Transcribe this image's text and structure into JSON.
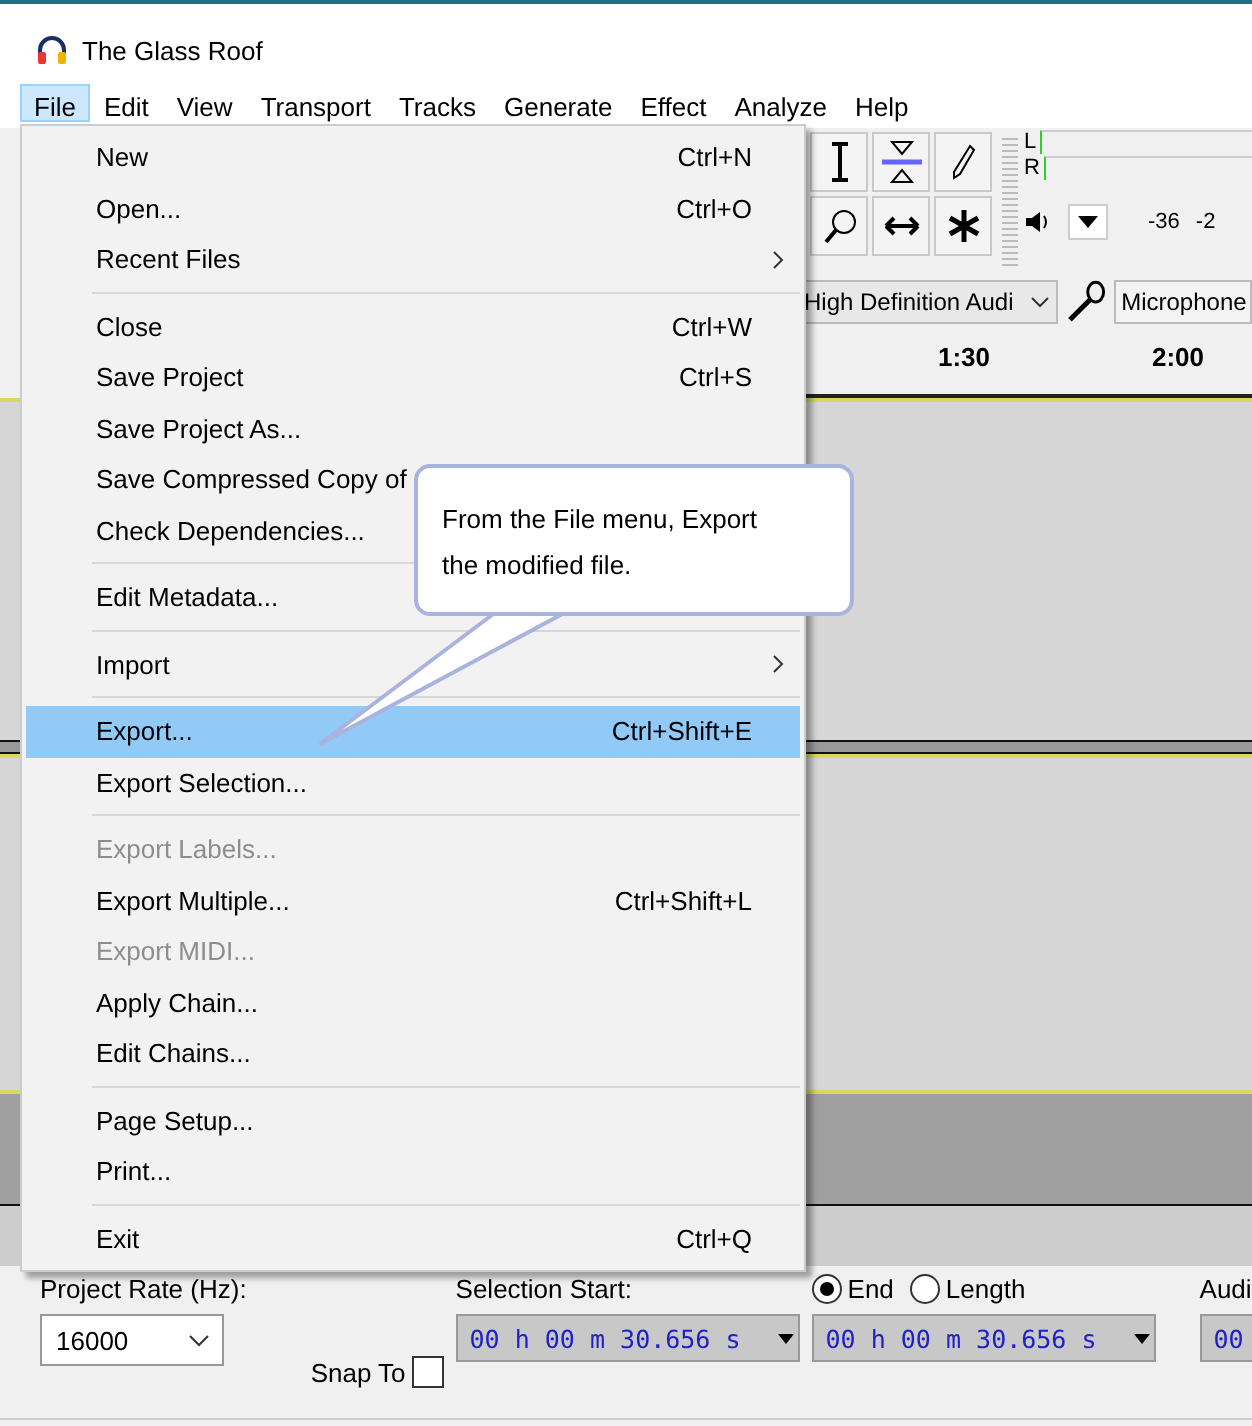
{
  "window": {
    "title": "The Glass Roof"
  },
  "menubar": [
    {
      "label": "File",
      "selected": true
    },
    {
      "label": "Edit",
      "selected": false
    },
    {
      "label": "View",
      "selected": false
    },
    {
      "label": "Transport",
      "selected": false
    },
    {
      "label": "Tracks",
      "selected": false
    },
    {
      "label": "Generate",
      "selected": false
    },
    {
      "label": "Effect",
      "selected": false
    },
    {
      "label": "Analyze",
      "selected": false
    },
    {
      "label": "Help",
      "selected": false
    }
  ],
  "file_menu": [
    {
      "kind": "item",
      "label": "New",
      "shortcut": "Ctrl+N",
      "submenu": false,
      "disabled": false,
      "selected": false
    },
    {
      "kind": "item",
      "label": "Open...",
      "shortcut": "Ctrl+O",
      "submenu": false,
      "disabled": false,
      "selected": false
    },
    {
      "kind": "item",
      "label": "Recent Files",
      "submenu": true,
      "disabled": false,
      "selected": false
    },
    {
      "kind": "separator"
    },
    {
      "kind": "item",
      "label": "Close",
      "shortcut": "Ctrl+W",
      "submenu": false,
      "disabled": false,
      "selected": false
    },
    {
      "kind": "item",
      "label": "Save Project",
      "shortcut": "Ctrl+S",
      "submenu": false,
      "disabled": false,
      "selected": false
    },
    {
      "kind": "item",
      "label": "Save Project As...",
      "submenu": false,
      "disabled": false,
      "selected": false
    },
    {
      "kind": "item",
      "label": "Save Compressed Copy of",
      "submenu": false,
      "disabled": false,
      "selected": false
    },
    {
      "kind": "item",
      "label": "Check Dependencies...",
      "submenu": false,
      "disabled": false,
      "selected": false
    },
    {
      "kind": "separator"
    },
    {
      "kind": "item",
      "label": "Edit Metadata...",
      "submenu": false,
      "disabled": false,
      "selected": false
    },
    {
      "kind": "separator"
    },
    {
      "kind": "item",
      "label": "Import",
      "submenu": true,
      "disabled": false,
      "selected": false
    },
    {
      "kind": "separator"
    },
    {
      "kind": "item",
      "label": "Export...",
      "shortcut": "Ctrl+Shift+E",
      "submenu": false,
      "disabled": false,
      "selected": true
    },
    {
      "kind": "item",
      "label": "Export Selection...",
      "submenu": false,
      "disabled": false,
      "selected": false
    },
    {
      "kind": "separator"
    },
    {
      "kind": "item",
      "label": "Export Labels...",
      "submenu": false,
      "disabled": true,
      "selected": false
    },
    {
      "kind": "item",
      "label": "Export Multiple...",
      "shortcut": "Ctrl+Shift+L",
      "submenu": false,
      "disabled": false,
      "selected": false
    },
    {
      "kind": "item",
      "label": "Export MIDI...",
      "submenu": false,
      "disabled": true,
      "selected": false
    },
    {
      "kind": "item",
      "label": "Apply Chain...",
      "submenu": false,
      "disabled": false,
      "selected": false
    },
    {
      "kind": "item",
      "label": "Edit Chains...",
      "submenu": false,
      "disabled": false,
      "selected": false
    },
    {
      "kind": "separator"
    },
    {
      "kind": "item",
      "label": "Page Setup...",
      "submenu": false,
      "disabled": false,
      "selected": false
    },
    {
      "kind": "item",
      "label": "Print...",
      "submenu": false,
      "disabled": false,
      "selected": false
    },
    {
      "kind": "separator"
    },
    {
      "kind": "item",
      "label": "Exit",
      "shortcut": "Ctrl+Q",
      "submenu": false,
      "disabled": false,
      "selected": false
    }
  ],
  "callout": {
    "text": "From the File menu, Export the modified file."
  },
  "meter": {
    "left": "L",
    "right": "R",
    "scale": [
      "-36",
      "-2"
    ]
  },
  "devices": {
    "playback": "High Definition Audi",
    "recording": "Microphone"
  },
  "ruler": [
    "1:30",
    "2:00"
  ],
  "selection_bar": {
    "rate_label": "Project Rate (Hz):",
    "rate": "16000",
    "snap_label": "Snap To",
    "snap_checked": false,
    "start_label": "Selection Start:",
    "modes": [
      {
        "label": "End",
        "selected": true
      },
      {
        "label": "Length",
        "selected": false
      }
    ],
    "start_time": "00 h 00 m 30.656 s",
    "end_time": "00 h 00 m 30.656 s",
    "audio_label": "Audi",
    "audio_time": "00"
  }
}
